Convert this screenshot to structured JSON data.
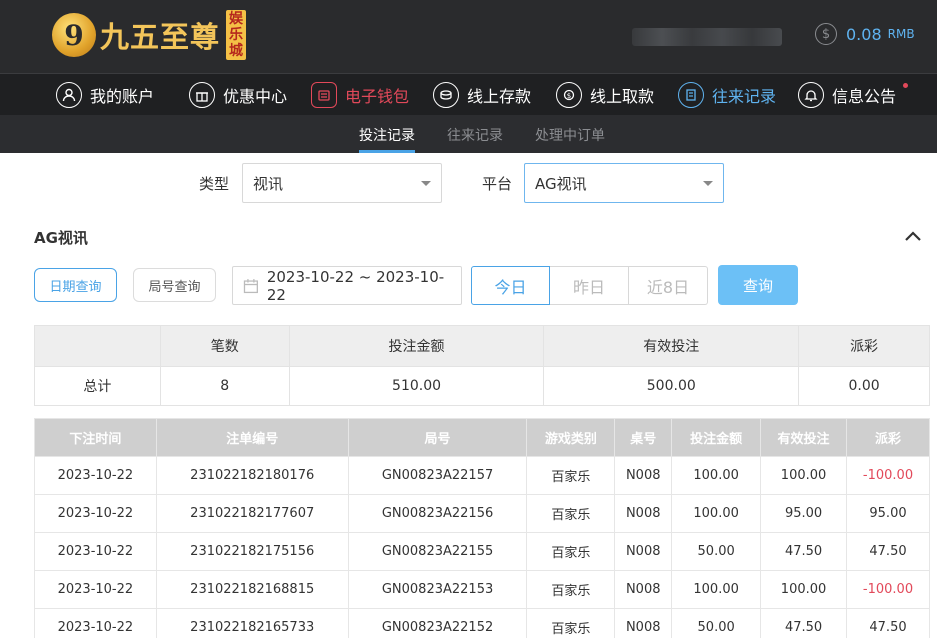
{
  "header": {
    "logo_mark": "9",
    "logo_text": "九五至尊",
    "logo_badge": [
      "娱",
      "乐",
      "城"
    ],
    "balance_amount": "0.08",
    "balance_unit": "RMB"
  },
  "nav": {
    "items": [
      {
        "label": "我的账户",
        "icon": "user-icon"
      },
      {
        "label": "优惠中心",
        "icon": "gift-icon"
      },
      {
        "label": "电子钱包",
        "icon": "wallet-icon"
      },
      {
        "label": "线上存款",
        "icon": "deposit-icon"
      },
      {
        "label": "线上取款",
        "icon": "withdraw-icon"
      },
      {
        "label": "往来记录",
        "icon": "records-icon"
      },
      {
        "label": "信息公告",
        "icon": "bell-icon"
      }
    ]
  },
  "subnav": {
    "tabs": [
      "投注记录",
      "往来记录",
      "处理中订单"
    ]
  },
  "filters": {
    "type_label": "类型",
    "type_value": "视讯",
    "platform_label": "平台",
    "platform_value": "AG视讯"
  },
  "section": {
    "title": "AG视讯",
    "mode_date": "日期查询",
    "mode_round": "局号查询",
    "date_range": "2023-10-22 ~ 2023-10-22",
    "quick_today": "今日",
    "quick_yesterday": "昨日",
    "quick_8days": "近8日",
    "query_button": "查询"
  },
  "summary": {
    "headers": [
      "",
      "笔数",
      "投注金额",
      "有效投注",
      "派彩"
    ],
    "row": [
      "总计",
      "8",
      "510.00",
      "500.00",
      "0.00"
    ]
  },
  "detail": {
    "headers": [
      "下注时间",
      "注单编号",
      "局号",
      "游戏类别",
      "桌号",
      "投注金额",
      "有效投注",
      "派彩"
    ],
    "rows": [
      [
        "2023-10-22",
        "231022182180176",
        "GN00823A22157",
        "百家乐",
        "N008",
        "100.00",
        "100.00",
        "-100.00"
      ],
      [
        "2023-10-22",
        "231022182177607",
        "GN00823A22156",
        "百家乐",
        "N008",
        "100.00",
        "95.00",
        "95.00"
      ],
      [
        "2023-10-22",
        "231022182175156",
        "GN00823A22155",
        "百家乐",
        "N008",
        "50.00",
        "47.50",
        "47.50"
      ],
      [
        "2023-10-22",
        "231022182168815",
        "GN00823A22153",
        "百家乐",
        "N008",
        "100.00",
        "100.00",
        "-100.00"
      ],
      [
        "2023-10-22",
        "231022182165733",
        "GN00823A22152",
        "百家乐",
        "N008",
        "50.00",
        "47.50",
        "47.50"
      ]
    ]
  },
  "colors": {
    "accent": "#4aa3e6",
    "negative": "#e2495a",
    "header_bg": "#2a2b2d",
    "gold": "#f3c55a"
  }
}
